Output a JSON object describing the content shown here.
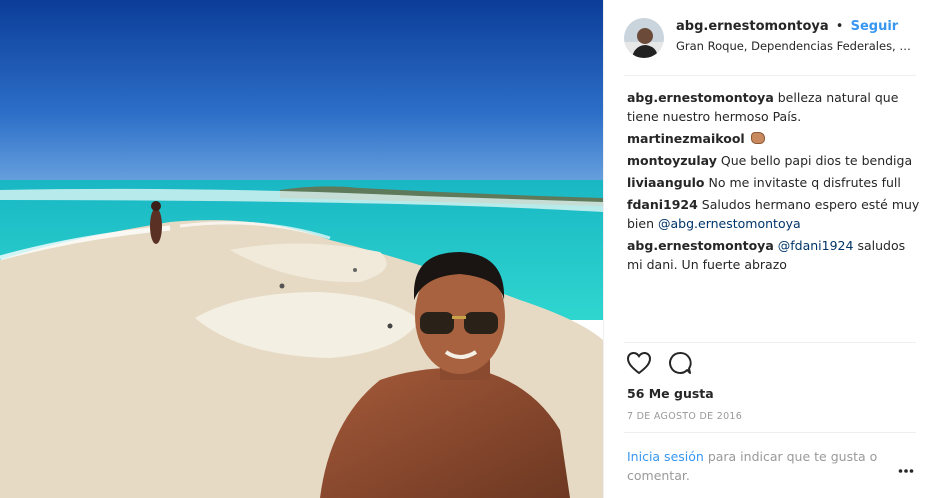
{
  "post": {
    "username": "abg.ernestomontoya",
    "separator": "•",
    "follow_label": "Seguir",
    "location": "Gran Roque, Dependencias Federales, Venezuela"
  },
  "comments": [
    {
      "user": "abg.ernestomontoya",
      "text": "belleza natural que tiene nuestro hermoso País."
    },
    {
      "user": "martinezmaikool",
      "text": "",
      "emoji": "oncoming-fist"
    },
    {
      "user": "montoyzulay",
      "text": "Que bello papi dios te bendiga"
    },
    {
      "user": "liviaangulo",
      "text": "No me invitaste q disfrutes full"
    },
    {
      "user": "fdani1924",
      "text": "Saludos hermano espero esté muy bien",
      "mention": "@abg.ernestomontoya"
    },
    {
      "user": "abg.ernestomontoya",
      "mention": "@fdani1924",
      "text": "saludos mi dani. Un fuerte abrazo"
    }
  ],
  "likes": "56 Me gusta",
  "date": "7 DE AGOSTO DE 2016",
  "login_prompt": {
    "link": "Inicia sesión",
    "text": "para indicar que te gusta o comentar."
  },
  "icons": [
    "heart-icon",
    "comment-icon",
    "more-options-icon"
  ],
  "colors": {
    "link": "#3897f0",
    "mention": "#003569",
    "muted": "#999999"
  }
}
